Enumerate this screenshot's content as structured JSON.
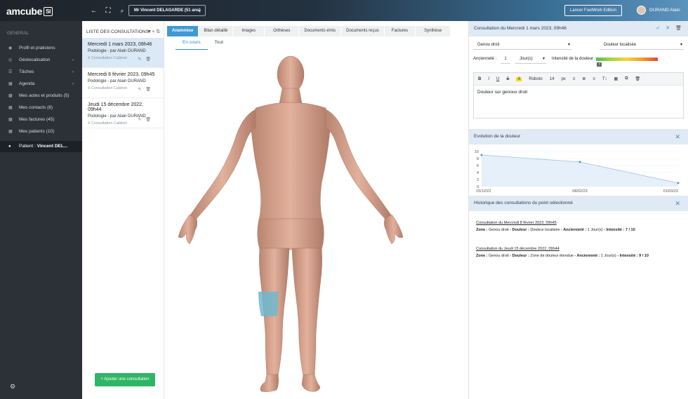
{
  "header": {
    "logo_text": "amcube",
    "logo_badge": "SI",
    "patient_selector": "Mr Vincent DELAGARDE (51 ans)",
    "launch_button": "Lancer FootWork Edition",
    "user_name": "DURAND Alain",
    "icons": [
      "back-arrow-icon",
      "fullscreen-icon",
      "search-icon",
      "chevron-down-icon"
    ]
  },
  "sidebar": {
    "section": "GENERAL",
    "items": [
      {
        "label": "Profil et praticiens",
        "icon": "user-icon"
      },
      {
        "label": "Géolocalisation",
        "icon": "location-icon",
        "arrow": "›"
      },
      {
        "label": "Tâches",
        "icon": "tasks-icon",
        "arrow": "›"
      },
      {
        "label": "Agenda",
        "icon": "calendar-icon",
        "arrow": "›"
      },
      {
        "label": "Mes actes et produits (5)",
        "icon": "grid-icon"
      },
      {
        "label": "Mes contacts (8)",
        "icon": "grid-icon"
      },
      {
        "label": "Mes factures (45)",
        "icon": "grid-icon"
      },
      {
        "label": "Mes patients (10)",
        "icon": "grid-icon"
      }
    ],
    "active_prefix": "Patient : ",
    "active_name": "Vincent DEL..."
  },
  "list": {
    "title": "LISTE DES CONSULTATIONS",
    "tools": "▼+ ⇅",
    "consultations": [
      {
        "date": "Mercredi 1 mars 2023, 09h46",
        "who": "Podologie - par Alain DURAND",
        "place": "Consultation Cabinet"
      },
      {
        "date": "Mercredi 8 février 2023, 09h45",
        "who": "Podologie - par Alain DURAND",
        "place": "Consultation Cabinet"
      },
      {
        "date": "Jeudi 15 décembre 2022, 09h44",
        "who": "Podologie - par Alain DURAND",
        "place": "Consultation Cabinet"
      }
    ],
    "add_button": "+ Ajouter une consultation"
  },
  "center": {
    "tabs": [
      "Anamnèse",
      "Bilan détaillé",
      "Images",
      "Orthèses",
      "Documents émis",
      "Documents reçus",
      "Factures",
      "Synthèse"
    ],
    "active_tab": 0,
    "subtabs": [
      "En cours",
      "Tout"
    ],
    "active_subtab": 0
  },
  "detail": {
    "title": "Consultation du Mercredi 1 mars 2023, 09h46",
    "zone": "Genou droit",
    "pain_type": "Douleur localisée",
    "anciennete_label": "Ancienneté :",
    "anciennete_value": "1",
    "anciennete_unit": "Jour(s)",
    "intensity_label": "Intensité de la douleur :",
    "intensity_value": "7",
    "toolbar": {
      "bold": "B",
      "italic": "I",
      "underline": "U",
      "strike": "S",
      "color": "A",
      "font": "Roboto",
      "size": "14",
      "unit": "px",
      "ul": "≡",
      "ol": "≣",
      "align": "≡",
      "text_size": "T↕"
    },
    "note": "Douleur sur genoux droit",
    "colors": {
      "accent": "#3f9ad3",
      "green": "#2fb565",
      "header_bg": "#dfeaf4"
    }
  },
  "evolution": {
    "title": "Evolution de la douleur"
  },
  "chart_data": {
    "type": "area",
    "x": [
      "15/12/22",
      "08/02/23",
      "01/03/23"
    ],
    "y": [
      9,
      7,
      1
    ],
    "ylim": [
      0,
      10
    ],
    "yticks": [
      0,
      2,
      4,
      6,
      8,
      10
    ],
    "title": "",
    "xlabel": "",
    "ylabel": ""
  },
  "history": {
    "title": "Historique des consultations du point sélectionné",
    "entries": [
      {
        "title": "Consultation du Mercredi 8 février 2023, 09h45",
        "zone_label": "Zone :",
        "zone": "Genou droit",
        "douleur_label": "- Douleur :",
        "douleur": "Douleur localisée",
        "anc_label": "- Ancienneté :",
        "anc": "1 Jour(s)",
        "int_label": "- Intensité :",
        "int": "7 / 10"
      },
      {
        "title": "Consultation du Jeudi 15 décembre 2022, 09h44",
        "zone_label": "Zone :",
        "zone": "Genou droit",
        "douleur_label": "- Douleur :",
        "douleur": "Zone de douleur étendue",
        "anc_label": "- Ancienneté :",
        "anc": "1 Jour(s)",
        "int_label": "- Intensité :",
        "int": "9 / 10"
      }
    ]
  }
}
